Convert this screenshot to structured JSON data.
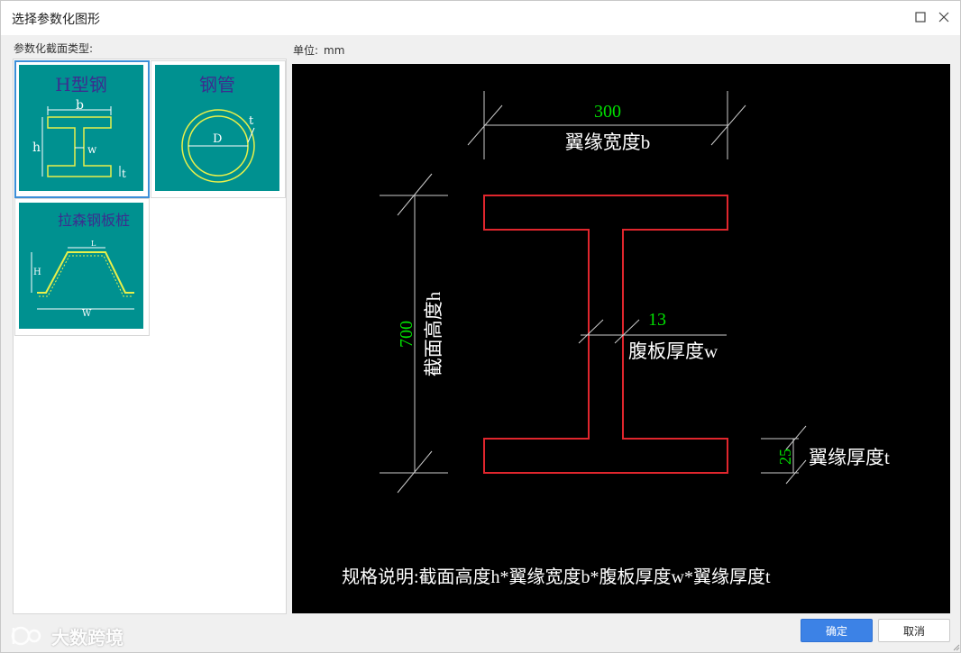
{
  "window": {
    "title": "选择参数化图形",
    "maximize_icon": "maximize-icon",
    "close_icon": "close-icon"
  },
  "sidebar": {
    "label": "参数化截面类型:",
    "items": [
      {
        "label": "H型钢",
        "selected": true,
        "thumb_labels": {
          "b": "b",
          "h": "h",
          "w": "w",
          "t": "t"
        }
      },
      {
        "label": "钢管",
        "selected": false,
        "thumb_labels": {
          "D": "D",
          "t": "t"
        }
      },
      {
        "label": "拉森钢板桩",
        "selected": false,
        "thumb_labels": {
          "H": "H",
          "W": "W",
          "L": "L"
        }
      }
    ]
  },
  "unit": {
    "label": "单位:",
    "value": "mm"
  },
  "preview": {
    "flange_width_value": "300",
    "flange_width_label": "翼缘宽度b",
    "height_value": "700",
    "height_label": "截面高度h",
    "web_thickness_value": "13",
    "web_thickness_label": "腹板厚度w",
    "flange_thickness_value": "25",
    "flange_thickness_label": "翼缘厚度t",
    "spec_note": "规格说明:截面高度h*翼缘宽度b*腹板厚度w*翼缘厚度t",
    "colors": {
      "dim_value": "#00e000",
      "outline": "#e0262d",
      "text": "#ffffff",
      "background": "#000000"
    }
  },
  "footer": {
    "ok_label": "确定",
    "cancel_label": "取消"
  },
  "watermark": {
    "text": "大数跨境"
  }
}
